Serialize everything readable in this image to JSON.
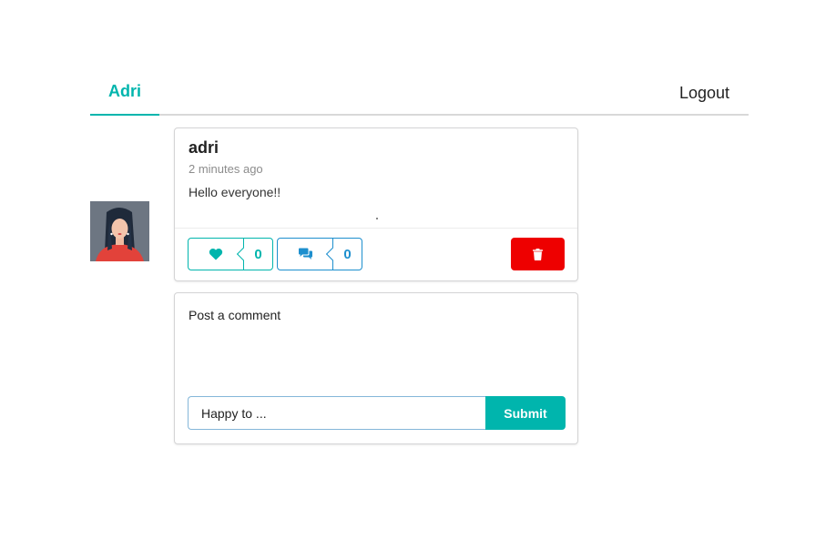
{
  "nav": {
    "active_tab": "Adri",
    "logout_label": "Logout"
  },
  "post": {
    "author": "adri",
    "time_ago": "2 minutes ago",
    "text": "Hello everyone!!",
    "like_count": "0",
    "comment_count": "0"
  },
  "comment_form": {
    "heading": "Post a comment",
    "input_value": "Happy to ...",
    "submit_label": "Submit"
  },
  "colors": {
    "accent": "#00b5ad",
    "comment_blue": "#1d8fce",
    "delete_red": "#ee0000"
  },
  "icons": {
    "like": "heart-icon",
    "comment": "comments-icon",
    "delete": "trash-icon"
  }
}
